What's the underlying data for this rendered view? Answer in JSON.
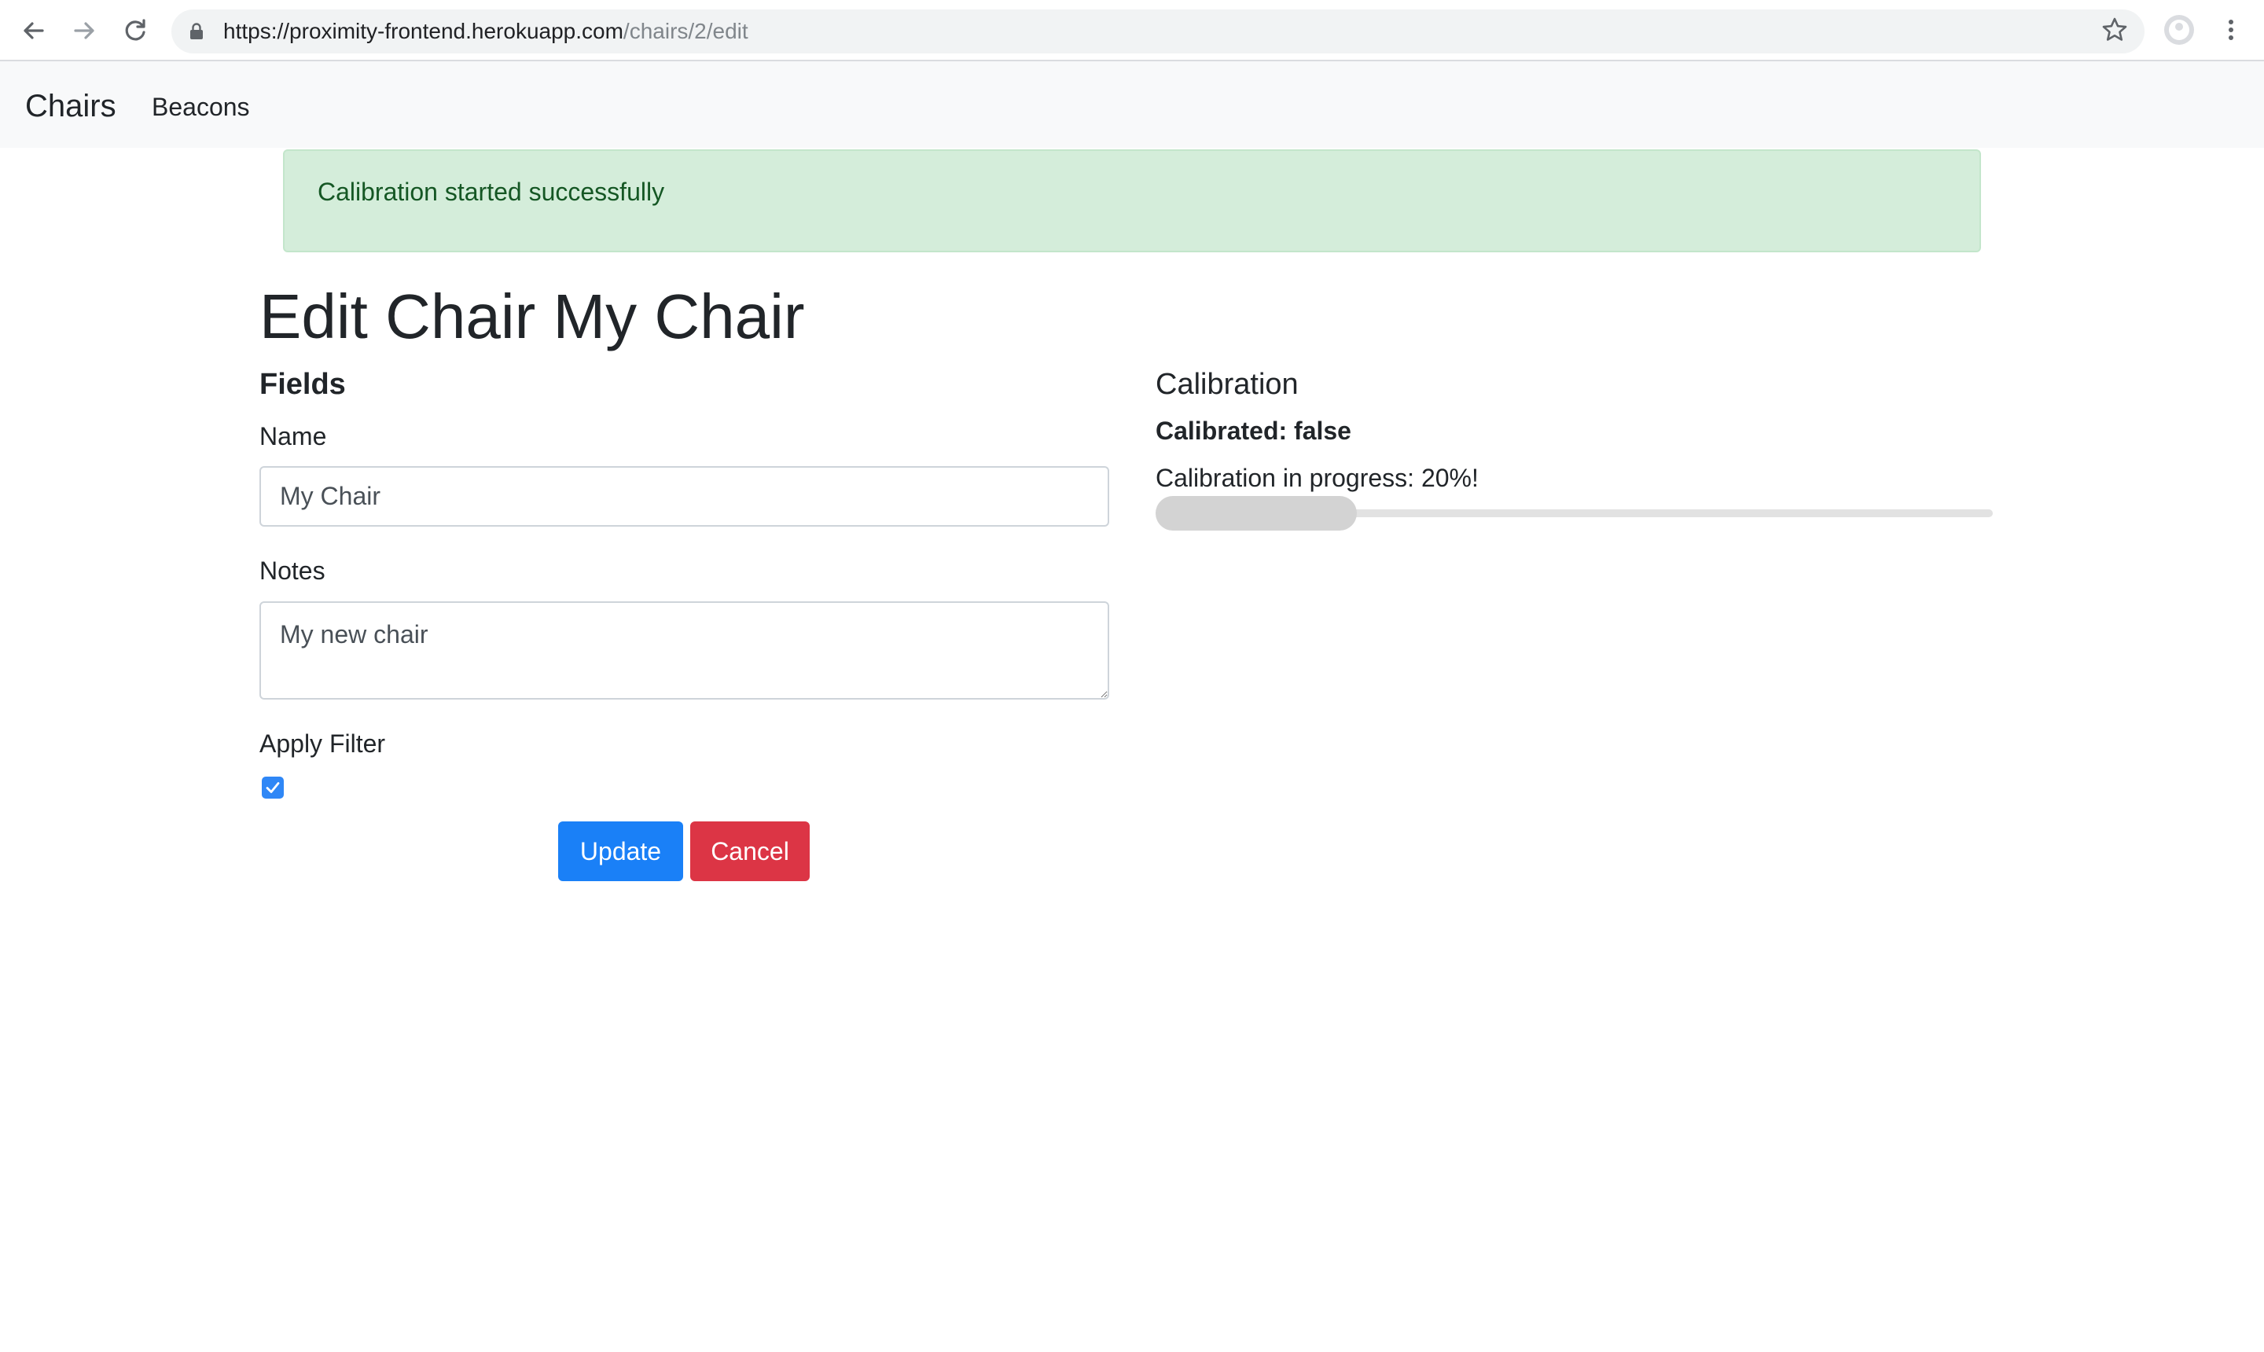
{
  "browser": {
    "url_host": "https://proximity-frontend.herokuapp.com",
    "url_path": "/chairs/2/edit"
  },
  "navbar": {
    "brand": "Chairs",
    "links": [
      "Beacons"
    ]
  },
  "alert": {
    "message": "Calibration started successfully",
    "color": "#d4edda"
  },
  "page": {
    "title": "Edit Chair My Chair"
  },
  "fields": {
    "heading": "Fields",
    "name_label": "Name",
    "name_value": "My Chair",
    "notes_label": "Notes",
    "notes_value": "My new chair",
    "apply_filter_label": "Apply Filter",
    "apply_filter_checked": true,
    "update_label": "Update",
    "cancel_label": "Cancel"
  },
  "calibration": {
    "heading": "Calibration",
    "status_text": "Calibrated: false",
    "progress_text": "Calibration in progress: 20%!",
    "progress_value": 0.2
  },
  "icons": {
    "back": "arrow-left-icon",
    "forward": "arrow-right-icon",
    "reload": "reload-icon",
    "lock": "lock-icon",
    "star": "star-icon",
    "profile": "profile-icon",
    "menu": "kebab-menu-icon",
    "checkbox": "checkmark-icon"
  },
  "colors": {
    "primary": "#1a80f7",
    "danger": "#dc3545",
    "success_text": "#155724"
  }
}
